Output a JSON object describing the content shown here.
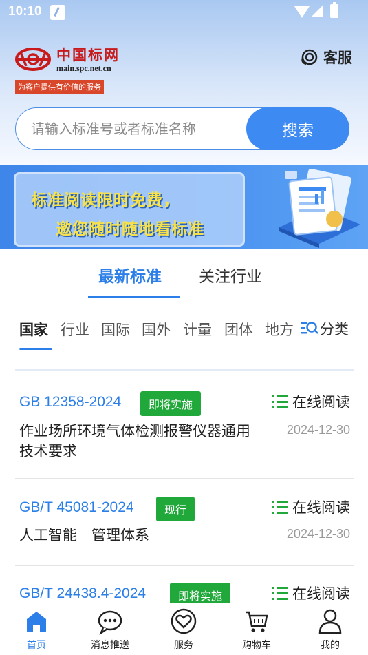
{
  "status_bar": {
    "time": "10:10"
  },
  "header": {
    "logo_cn": "中国标网",
    "logo_url": "main.spc.net.cn",
    "logo_tagline": "为客户提供有价值的服务",
    "service_label": "客服"
  },
  "search": {
    "placeholder": "请输入标准号或者标准名称",
    "button_label": "搜索"
  },
  "banner": {
    "line1": "标准阅读限时免费，",
    "line2": "邀您随时随地看标准"
  },
  "main_tabs": [
    {
      "label": "最新标准",
      "active": true
    },
    {
      "label": "关注行业",
      "active": false
    }
  ],
  "categories": [
    {
      "label": "国家",
      "active": true
    },
    {
      "label": "行业"
    },
    {
      "label": "国际"
    },
    {
      "label": "国外"
    },
    {
      "label": "计量"
    },
    {
      "label": "团体"
    },
    {
      "label": "地方"
    }
  ],
  "classify_label": "分类",
  "standards": [
    {
      "code": "GB 12358-2024",
      "status": "即将实施",
      "read_label": "在线阅读",
      "title": "作业场所环境气体检测报警仪器通用技术要求",
      "date": "2024-12-30"
    },
    {
      "code": "GB/T 45081-2024",
      "status": "现行",
      "read_label": "在线阅读",
      "title": "人工智能　管理体系",
      "date": "2024-12-30"
    },
    {
      "code": "GB/T 24438.4-2024",
      "status": "即将实施",
      "read_label": "在线阅读",
      "title": "",
      "date": ""
    }
  ],
  "bottom_nav": [
    {
      "label": "首页",
      "icon": "home-icon",
      "active": true
    },
    {
      "label": "消息推送",
      "icon": "message-icon"
    },
    {
      "label": "服务",
      "icon": "heart-icon"
    },
    {
      "label": "购物车",
      "icon": "cart-icon"
    },
    {
      "label": "我的",
      "icon": "user-icon"
    }
  ],
  "colors": {
    "accent": "#2c7fe8",
    "search_button": "#3d8bf2",
    "badge_green": "#21a83a",
    "logo_red": "#c8191b"
  }
}
